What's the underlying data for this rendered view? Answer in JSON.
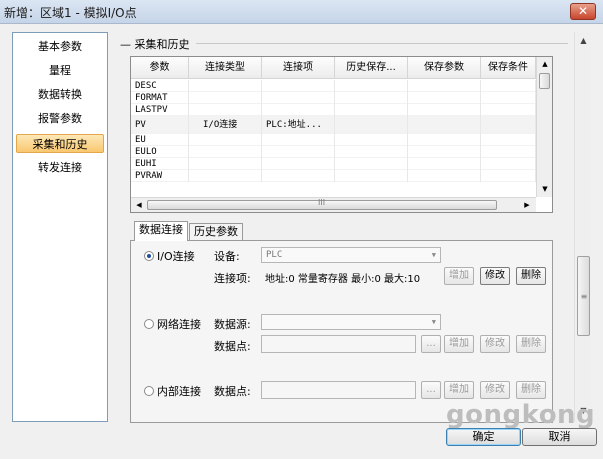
{
  "window": {
    "title": "新增：区域1 - 模拟I/O点",
    "close_glyph": "✕"
  },
  "sidebar": {
    "items": [
      {
        "label": "基本参数"
      },
      {
        "label": "量程"
      },
      {
        "label": "数据转换"
      },
      {
        "label": "报警参数"
      },
      {
        "label": "采集和历史",
        "active": true
      },
      {
        "label": "转发连接"
      }
    ]
  },
  "section": {
    "title": "采集和历史"
  },
  "grid": {
    "columns": [
      "参数",
      "连接类型",
      "连接项",
      "历史保存...",
      "保存参数",
      "保存条件"
    ],
    "rows": [
      [
        "DESC",
        "",
        "",
        "",
        "",
        ""
      ],
      [
        "FORMAT",
        "",
        "",
        "",
        "",
        ""
      ],
      [
        "LASTPV",
        "",
        "",
        "",
        "",
        ""
      ],
      [
        "PV",
        "I/O连接",
        "PLC:地址...",
        "",
        "",
        ""
      ],
      [
        "EU",
        "",
        "",
        "",
        "",
        ""
      ],
      [
        "EULO",
        "",
        "",
        "",
        "",
        ""
      ],
      [
        "EUHI",
        "",
        "",
        "",
        "",
        ""
      ],
      [
        "PVRAW",
        "",
        "",
        "",
        "",
        ""
      ]
    ],
    "selected_row": 3,
    "hscroll_grip": "III"
  },
  "tabs": [
    {
      "label": "数据连接",
      "active": true
    },
    {
      "label": "历史参数"
    }
  ],
  "io_connection": {
    "radio_label": "I/O连接",
    "selected": true,
    "device_label": "设备:",
    "device_value": "PLC",
    "item_label": "连接项:",
    "item_value": "地址:0 常量寄存器 最小:0 最大:10",
    "add": "增加",
    "edit": "修改",
    "delete": "删除"
  },
  "network_connection": {
    "radio_label": "网络连接",
    "source_label": "数据源:",
    "source_value": "",
    "point_label": "数据点:",
    "browse": "...",
    "add": "增加",
    "edit": "修改",
    "delete": "删除"
  },
  "internal_connection": {
    "radio_label": "内部连接",
    "point_label": "数据点:",
    "browse": "...",
    "add": "增加",
    "edit": "修改",
    "delete": "删除"
  },
  "watermark": "gongkong",
  "buttons": {
    "ok": "确定",
    "cancel": "取消"
  }
}
